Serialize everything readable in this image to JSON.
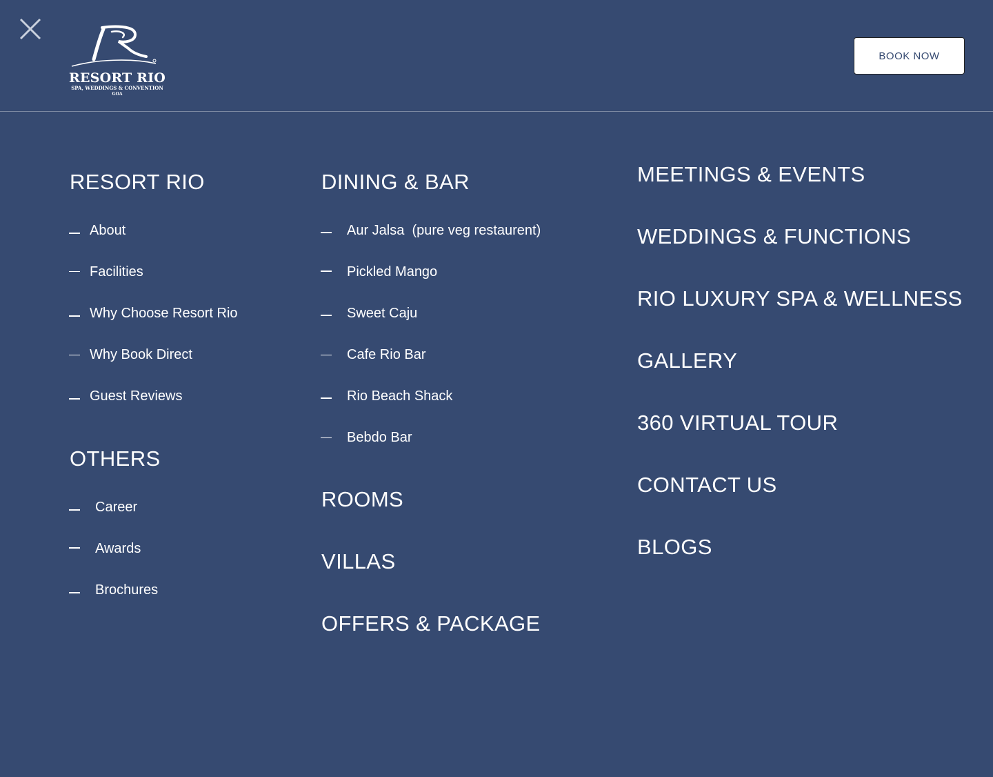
{
  "header": {
    "close_icon": "close-icon",
    "logo": {
      "name": "RESORT RIO",
      "tagline": "SPA, WEDDINGS & CONVENTION",
      "city": "GOA"
    },
    "book_now_label": "BOOK NOW"
  },
  "col1": {
    "resort_heading": "RESORT RIO",
    "resort_items": [
      "About",
      "Facilities",
      "Why Choose Resort Rio",
      "Why Book Direct",
      "Guest Reviews"
    ],
    "others_heading": "OTHERS",
    "others_items": [
      "Career",
      "Awards",
      "Brochures"
    ]
  },
  "col2": {
    "dining_heading": "DINING & BAR",
    "dining_items": [
      "Aur Jalsa  (pure veg restaurent)",
      "Pickled Mango",
      "Sweet Caju",
      "Cafe Rio Bar",
      "Rio Beach Shack",
      "Bebdo Bar"
    ],
    "rooms": "ROOMS",
    "villas": "VILLAS",
    "offers": "OFFERS & PACKAGE"
  },
  "col3": {
    "items": [
      "MEETINGS & EVENTS",
      "WEDDINGS & FUNCTIONS",
      "RIO LUXURY SPA & WELLNESS",
      "GALLERY",
      "360 VIRTUAL TOUR",
      "CONTACT US",
      "BLOGS"
    ]
  },
  "colors": {
    "background": "#364a71",
    "text": "#ffffff",
    "button_bg": "#ffffff",
    "button_text": "#364a71"
  }
}
